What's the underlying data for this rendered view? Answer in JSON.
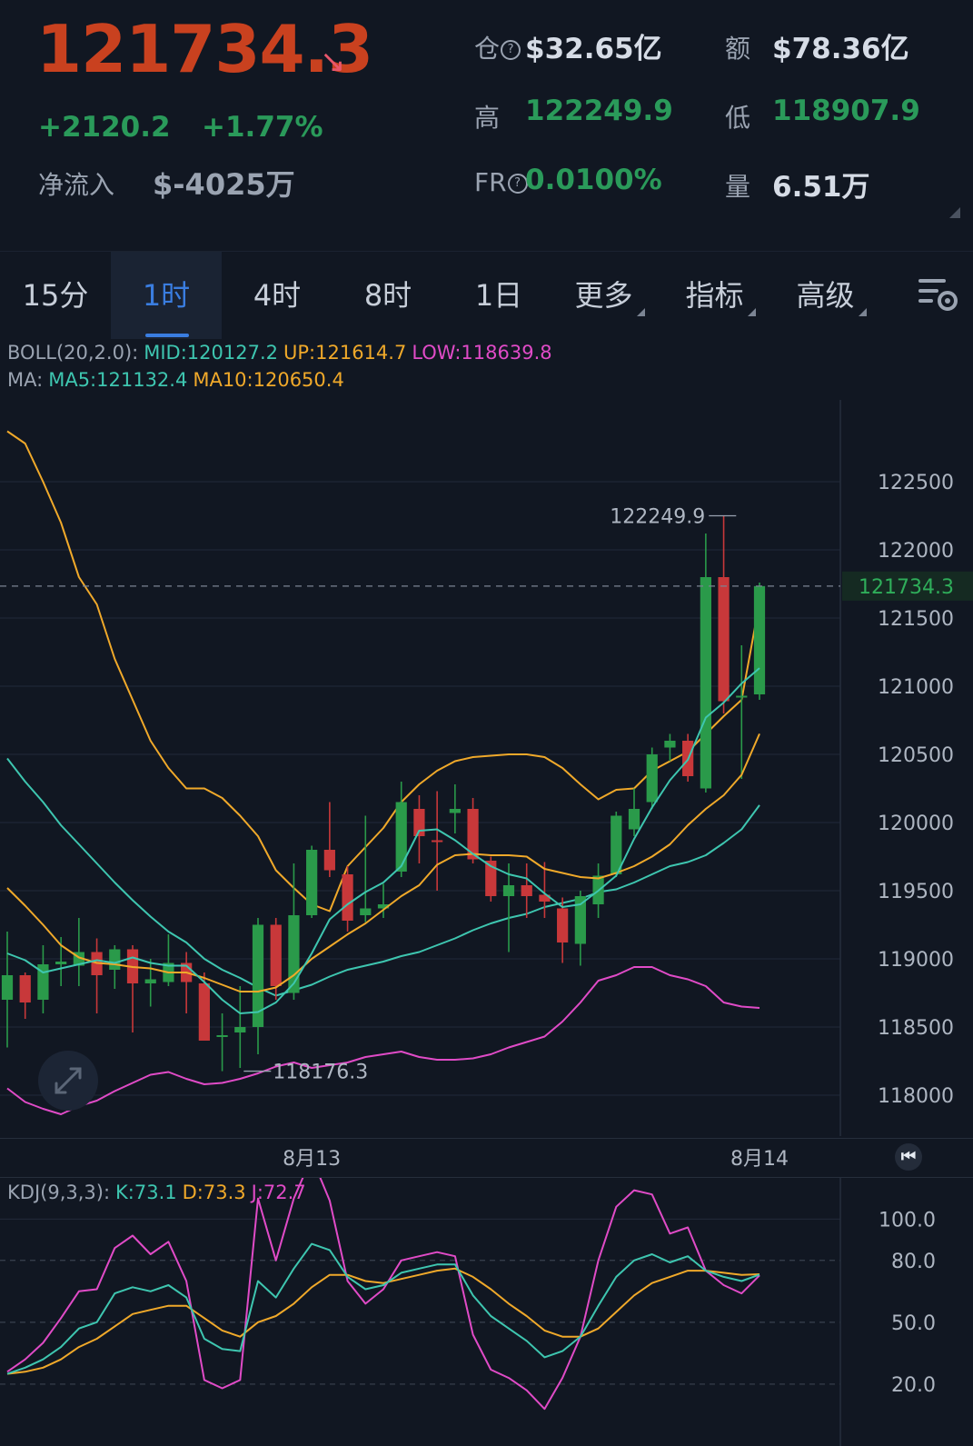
{
  "ticker": {
    "last_price": "121734.3",
    "change": "+2120.2",
    "change_pct": "+1.77%",
    "net_inflow_label": "净流入",
    "net_inflow_value": "$-4025万",
    "open_interest_label": "仓",
    "open_interest_value": "$32.65亿",
    "turnover_label": "额",
    "turnover_value": "$78.36亿",
    "high_label": "高",
    "high_value": "122249.9",
    "low_label": "低",
    "low_value": "118907.9",
    "funding_rate_label": "FR",
    "funding_rate_value": "0.0100%",
    "volume_label": "量",
    "volume_value": "6.51万"
  },
  "tabs": [
    {
      "label": "15分",
      "active": false
    },
    {
      "label": "1时",
      "active": true
    },
    {
      "label": "4时",
      "active": false
    },
    {
      "label": "8时",
      "active": false
    },
    {
      "label": "1日",
      "active": false
    },
    {
      "label": "更多",
      "active": false
    },
    {
      "label": "指标",
      "active": false
    },
    {
      "label": "高级",
      "active": false
    }
  ],
  "indicators": {
    "boll_label": "BOLL(20,2.0):",
    "boll_mid": "MID:120127.2",
    "boll_up": "UP:121614.7",
    "boll_low": "LOW:118639.8",
    "ma_label": "MA:",
    "ma5": "MA5:121132.4",
    "ma10": "MA10:120650.4",
    "kdj_label": "KDJ(9,3,3):",
    "kdj_k": "K:73.1",
    "kdj_d": "D:73.3",
    "kdj_j": "J:72.7"
  },
  "colors": {
    "up": "#2a9a4a",
    "down": "#c8383a",
    "mid": "#3ec6b0",
    "upper": "#f0a92a",
    "lower": "#e04bc7",
    "price_red": "#c9411f",
    "green_text": "#2a9a5a",
    "accent_blue": "#3a7de0"
  },
  "chart_data": [
    {
      "type": "candlestick",
      "interval": "1时",
      "y_ticks": [
        "122500",
        "122000",
        "121500",
        "121000",
        "120500",
        "120000",
        "119500",
        "119000",
        "118500",
        "118000"
      ],
      "ylim": [
        117700,
        123100
      ],
      "x_labels": [
        {
          "index": 17,
          "label": "8月13"
        },
        {
          "index": 42,
          "label": "8月14"
        }
      ],
      "current_price_label": "121734.3",
      "current_price": 121734.3,
      "max_marker": {
        "index": 41,
        "value": 122249.9,
        "label": "122249.9"
      },
      "min_marker": {
        "index": 13,
        "value": 118176.3,
        "label": "118176.3"
      },
      "candles": [
        {
          "o": 118700,
          "c": 118880,
          "h": 119200,
          "l": 118350
        },
        {
          "o": 118880,
          "c": 118680,
          "h": 118900,
          "l": 118560
        },
        {
          "o": 118700,
          "c": 118960,
          "h": 119100,
          "l": 118600
        },
        {
          "o": 118960,
          "c": 118980,
          "h": 119160,
          "l": 118800
        },
        {
          "o": 118950,
          "c": 119050,
          "h": 119300,
          "l": 118800
        },
        {
          "o": 119050,
          "c": 118880,
          "h": 119150,
          "l": 118600
        },
        {
          "o": 118920,
          "c": 119070,
          "h": 119100,
          "l": 118780
        },
        {
          "o": 119070,
          "c": 118820,
          "h": 119100,
          "l": 118460
        },
        {
          "o": 118820,
          "c": 118850,
          "h": 119000,
          "l": 118650
        },
        {
          "o": 118830,
          "c": 118970,
          "h": 119180,
          "l": 118800
        },
        {
          "o": 118970,
          "c": 118830,
          "h": 119050,
          "l": 118600
        },
        {
          "o": 118820,
          "c": 118400,
          "h": 118900,
          "l": 118400
        },
        {
          "o": 118440,
          "c": 118440,
          "h": 118600,
          "l": 118176.3
        },
        {
          "o": 118460,
          "c": 118500,
          "h": 118800,
          "l": 118200
        },
        {
          "o": 118500,
          "c": 119250,
          "h": 119300,
          "l": 118300
        },
        {
          "o": 119250,
          "c": 118800,
          "h": 119300,
          "l": 118700
        },
        {
          "o": 118750,
          "c": 119320,
          "h": 119700,
          "l": 118700
        },
        {
          "o": 119320,
          "c": 119800,
          "h": 119830,
          "l": 119300
        },
        {
          "o": 119800,
          "c": 119650,
          "h": 120150,
          "l": 119600
        },
        {
          "o": 119620,
          "c": 119280,
          "h": 119680,
          "l": 119200
        },
        {
          "o": 119320,
          "c": 119370,
          "h": 120050,
          "l": 119270
        },
        {
          "o": 119370,
          "c": 119400,
          "h": 119550,
          "l": 119300
        },
        {
          "o": 119640,
          "c": 120150,
          "h": 120300,
          "l": 119600
        },
        {
          "o": 120100,
          "c": 119900,
          "h": 120200,
          "l": 119700
        },
        {
          "o": 119870,
          "c": 119860,
          "h": 120230,
          "l": 119500
        },
        {
          "o": 120070,
          "c": 120100,
          "h": 120280,
          "l": 119920
        },
        {
          "o": 120100,
          "c": 119730,
          "h": 120180,
          "l": 119700
        },
        {
          "o": 119720,
          "c": 119460,
          "h": 119750,
          "l": 119420
        },
        {
          "o": 119460,
          "c": 119540,
          "h": 119700,
          "l": 119050
        },
        {
          "o": 119540,
          "c": 119460,
          "h": 119700,
          "l": 119300
        },
        {
          "o": 119470,
          "c": 119420,
          "h": 119710,
          "l": 119300
        },
        {
          "o": 119370,
          "c": 119120,
          "h": 119450,
          "l": 118970
        },
        {
          "o": 119110,
          "c": 119460,
          "h": 119500,
          "l": 118950
        },
        {
          "o": 119400,
          "c": 119610,
          "h": 119700,
          "l": 119300
        },
        {
          "o": 119620,
          "c": 120050,
          "h": 120080,
          "l": 119600
        },
        {
          "o": 119950,
          "c": 120100,
          "h": 120250,
          "l": 119900
        },
        {
          "o": 120150,
          "c": 120500,
          "h": 120550,
          "l": 120100
        },
        {
          "o": 120550,
          "c": 120600,
          "h": 120650,
          "l": 120450
        },
        {
          "o": 120600,
          "c": 120340,
          "h": 120650,
          "l": 120300
        },
        {
          "o": 120250,
          "c": 121800,
          "h": 122120,
          "l": 120220
        },
        {
          "o": 121800,
          "c": 120890,
          "h": 122249.9,
          "l": 120800
        },
        {
          "o": 120920,
          "c": 120930,
          "h": 121300,
          "l": 120320
        },
        {
          "o": 120940,
          "c": 121734.3,
          "h": 121760,
          "l": 120900
        }
      ],
      "ma5": [
        119040,
        118990,
        118900,
        118930,
        118960,
        118990,
        118970,
        119010,
        118970,
        118950,
        118950,
        118830,
        118700,
        118600,
        118610,
        118680,
        118820,
        119040,
        119290,
        119400,
        119490,
        119560,
        119680,
        119940,
        119950,
        119870,
        119770,
        119680,
        119620,
        119590,
        119480,
        119380,
        119400,
        119500,
        119610,
        119880,
        120110,
        120310,
        120460,
        120770,
        120880,
        121020,
        121132.4
      ],
      "ma10": [
        119520,
        119390,
        119250,
        119100,
        119010,
        118970,
        118960,
        118940,
        118930,
        118900,
        118900,
        118860,
        118810,
        118760,
        118760,
        118790,
        118880,
        119000,
        119090,
        119180,
        119260,
        119360,
        119460,
        119540,
        119690,
        119760,
        119770,
        119760,
        119760,
        119750,
        119660,
        119630,
        119600,
        119590,
        119630,
        119680,
        119750,
        119840,
        119980,
        120100,
        120200,
        120350,
        120650.4
      ],
      "boll_upper": [
        122870,
        122780,
        122500,
        122200,
        121800,
        121600,
        121200,
        120900,
        120600,
        120400,
        120250,
        120250,
        120180,
        120050,
        119900,
        119650,
        119520,
        119400,
        119350,
        119680,
        119820,
        119960,
        120150,
        120280,
        120380,
        120450,
        120480,
        120490,
        120500,
        120500,
        120480,
        120400,
        120280,
        120170,
        120240,
        120250,
        120380,
        120450,
        120520,
        120650,
        120780,
        120900,
        121614.7
      ],
      "boll_mid": [
        120470,
        120300,
        120150,
        119980,
        119840,
        119700,
        119560,
        119430,
        119310,
        119200,
        119120,
        119000,
        118920,
        118860,
        118790,
        118730,
        118770,
        118810,
        118870,
        118920,
        118950,
        118980,
        119020,
        119050,
        119100,
        119150,
        119210,
        119260,
        119300,
        119330,
        119380,
        119410,
        119440,
        119490,
        119510,
        119560,
        119620,
        119680,
        119710,
        119760,
        119850,
        119950,
        120127.2
      ],
      "boll_lower": [
        118050,
        117950,
        117900,
        117860,
        117920,
        117960,
        118030,
        118090,
        118150,
        118170,
        118120,
        118080,
        118090,
        118120,
        118160,
        118210,
        118240,
        118200,
        118220,
        118240,
        118280,
        118300,
        118320,
        118280,
        118260,
        118260,
        118270,
        118300,
        118350,
        118390,
        118430,
        118540,
        118680,
        118840,
        118880,
        118940,
        118940,
        118880,
        118850,
        118800,
        118680,
        118650,
        118639.8
      ]
    },
    {
      "type": "line",
      "title": "KDJ(9,3,3)",
      "y_ticks": [
        "100.0",
        "80.0",
        "50.0",
        "20.0"
      ],
      "ylim": [
        -10,
        120
      ],
      "K": [
        25,
        28,
        32,
        38,
        47,
        50,
        64,
        67,
        65,
        68,
        62,
        42,
        37,
        36,
        70,
        62,
        76,
        88,
        85,
        72,
        66,
        68,
        74,
        76,
        78,
        78,
        63,
        53,
        47,
        41,
        33,
        36,
        43,
        58,
        72,
        80,
        83,
        79,
        82,
        75,
        72,
        70,
        73.1
      ],
      "D": [
        25,
        26,
        28,
        32,
        38,
        42,
        48,
        54,
        56,
        58,
        58,
        52,
        46,
        43,
        50,
        53,
        59,
        67,
        73,
        73,
        70,
        69,
        71,
        73,
        75,
        76,
        72,
        66,
        59,
        53,
        46,
        43,
        43,
        47,
        55,
        63,
        69,
        72,
        75,
        75,
        74,
        73,
        73.3
      ],
      "J": [
        26,
        32,
        40,
        52,
        65,
        66,
        86,
        92,
        83,
        89,
        70,
        22,
        18,
        22,
        110,
        80,
        110,
        130,
        109,
        70,
        59,
        66,
        80,
        82,
        84,
        82,
        44,
        27,
        23,
        17,
        8,
        23,
        43,
        80,
        106,
        114,
        112,
        93,
        96,
        75,
        68,
        64,
        72.7
      ]
    }
  ]
}
